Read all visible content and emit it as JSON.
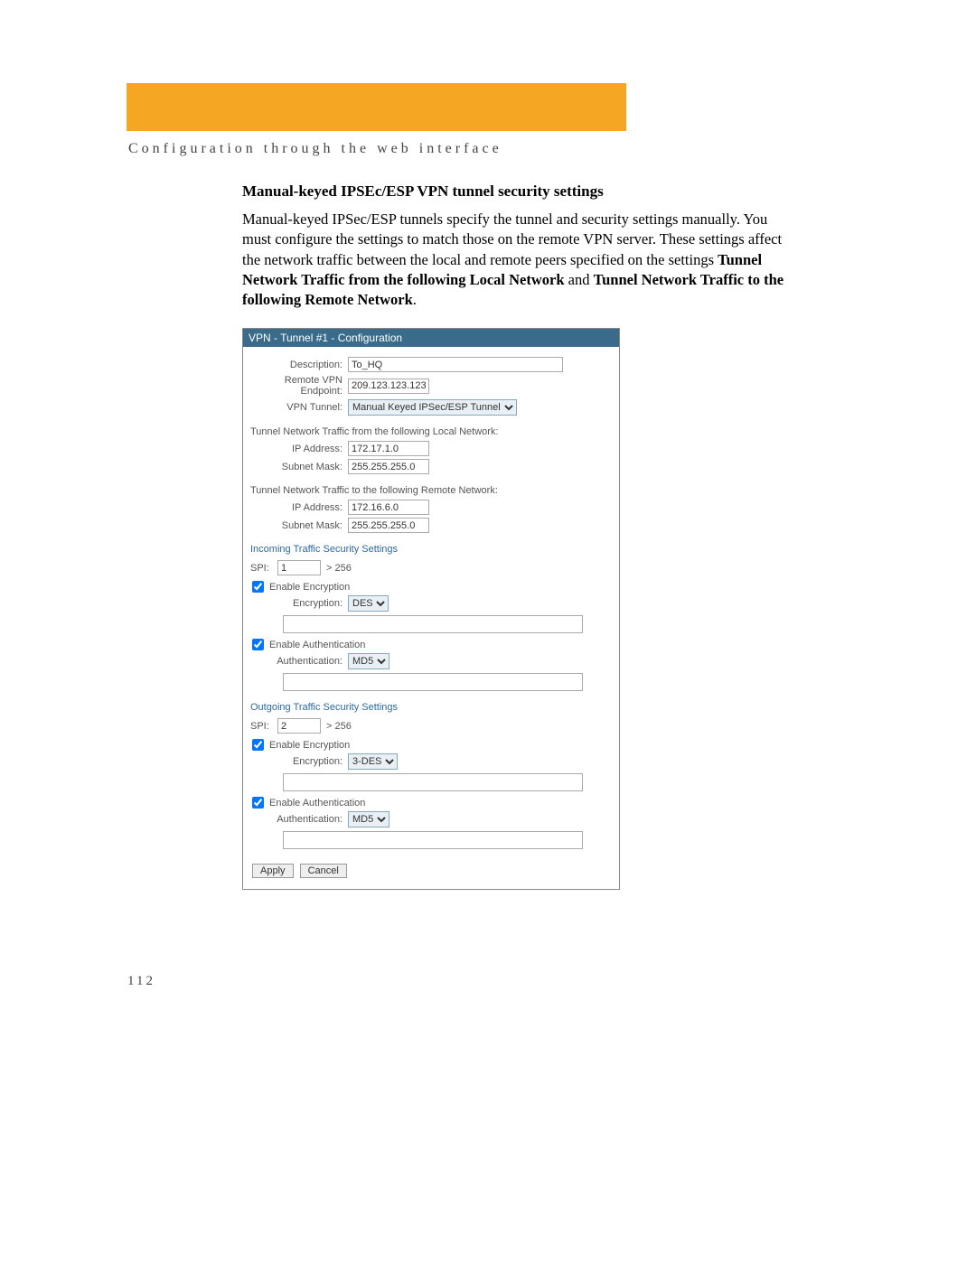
{
  "header": "Configuration through the web interface",
  "title": "Manual-keyed IPSEc/ESP VPN tunnel security settings",
  "paragraph": "Manual-keyed IPSec/ESP tunnels specify the tunnel and security settings manually. You must configure the settings to match those on the remote VPN server. These settings affect the network traffic between the local and remote peers specified on the settings ",
  "bold1": "Tunnel Network Traffic from the following Local Network",
  "and": " and ",
  "bold2": "Tunnel Network Traffic to the following Remote Network",
  "period": ".",
  "panel": {
    "titlebar": "VPN - Tunnel #1 - Configuration",
    "desc_label": "Description:",
    "desc_value": "To_HQ",
    "endpoint_label": "Remote VPN Endpoint:",
    "endpoint_value": "209.123.123.123",
    "vpntunnel_label": "VPN Tunnel:",
    "vpntunnel_value": "Manual Keyed IPSec/ESP Tunnel",
    "local_head": "Tunnel Network Traffic from the following Local Network:",
    "local_ip_label": "IP Address:",
    "local_ip_value": "172.17.1.0",
    "local_mask_label": "Subnet Mask:",
    "local_mask_value": "255.255.255.0",
    "remote_head": "Tunnel Network Traffic to the following Remote Network:",
    "remote_ip_label": "IP Address:",
    "remote_ip_value": "172.16.6.0",
    "remote_mask_label": "Subnet Mask:",
    "remote_mask_value": "255.255.255.0",
    "incoming_head": "Incoming Traffic Security Settings",
    "spi_label": "SPI:",
    "spi_in_value": "1",
    "spi_note": "> 256",
    "enable_enc": "Enable Encryption",
    "enc_label": "Encryption:",
    "enc_in_value": "DES",
    "enable_auth": "Enable Authentication",
    "auth_label": "Authentication:",
    "auth_value": "MD5",
    "outgoing_head": "Outgoing Traffic Security Settings",
    "spi_out_value": "2",
    "enc_out_value": "3-DES",
    "apply": "Apply",
    "cancel": "Cancel"
  },
  "page_number": "112"
}
